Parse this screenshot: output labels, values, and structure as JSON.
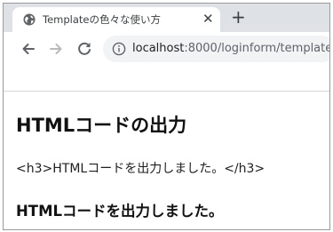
{
  "browser": {
    "tab": {
      "title": "Templateの色々な使い方",
      "favicon": "globe-icon",
      "close_glyph": "✕"
    },
    "new_tab_glyph": "+",
    "toolbar": {
      "back_icon": "arrow-left-icon",
      "forward_icon": "arrow-right-icon",
      "reload_icon": "reload-icon",
      "site_info_icon": "info-icon",
      "url_host": "localhost",
      "url_rest": ":8000/loginform/template/"
    },
    "colors": {
      "tabstrip_bg": "#dee1e6",
      "omnibox_bg": "#f1f3f4",
      "icon": "#5f6368"
    }
  },
  "page": {
    "heading": "HTMLコードの出力",
    "escaped_output": "<h3>HTMLコードを出力しました。</h3>",
    "rendered_output": "HTMLコードを出力しました。"
  }
}
